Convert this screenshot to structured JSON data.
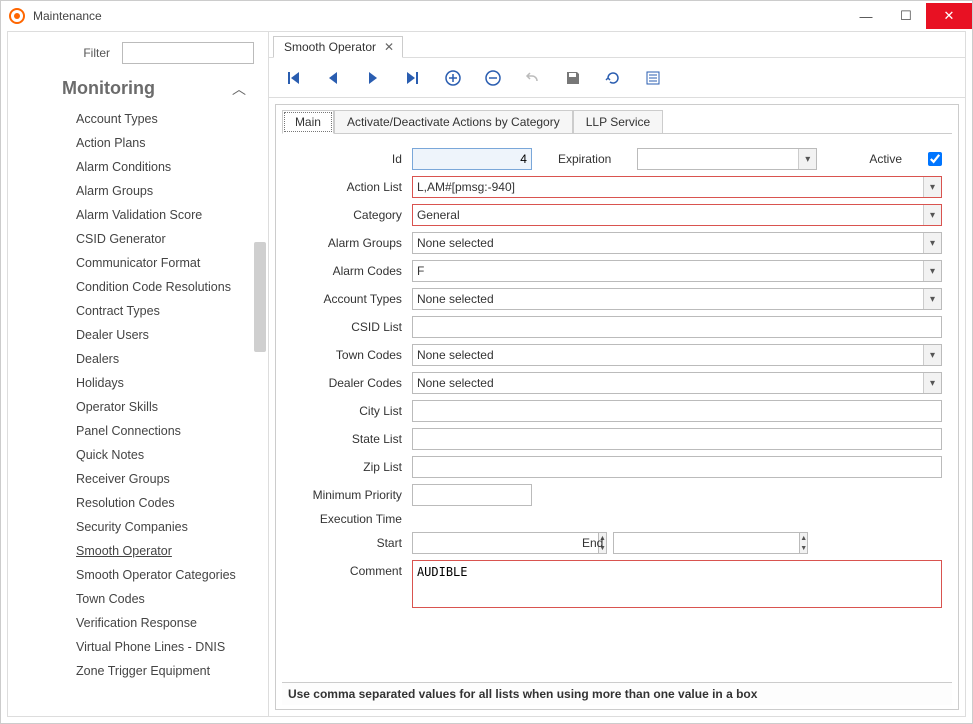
{
  "window": {
    "title": "Maintenance"
  },
  "sidebar": {
    "filter_label": "Filter",
    "filter_value": "",
    "section_title": "Monitoring",
    "items": [
      "Account Types",
      "Action Plans",
      "Alarm Conditions",
      "Alarm Groups",
      "Alarm Validation Score",
      "CSID Generator",
      "Communicator Format",
      "Condition Code Resolutions",
      "Contract Types",
      "Dealer Users",
      "Dealers",
      "Holidays",
      "Operator Skills",
      "Panel Connections",
      "Quick Notes",
      "Receiver Groups",
      "Resolution Codes",
      "Security Companies",
      "Smooth Operator",
      "Smooth Operator Categories",
      "Town Codes",
      "Verification Response",
      "Virtual Phone Lines - DNIS",
      "Zone Trigger Equipment"
    ],
    "selected_index": 18
  },
  "doc_tab": {
    "label": "Smooth Operator"
  },
  "subtabs": [
    "Main",
    "Activate/Deactivate Actions by Category",
    "LLP Service"
  ],
  "active_subtab": 0,
  "form": {
    "id_label": "Id",
    "id_value": "4",
    "expiration_label": "Expiration",
    "expiration_value": "",
    "active_label": "Active",
    "active_checked": true,
    "action_list_label": "Action List",
    "action_list_value": "L,AM#[pmsg:-940]",
    "category_label": "Category",
    "category_value": "General",
    "alarm_groups_label": "Alarm Groups",
    "alarm_groups_value": "None selected",
    "alarm_codes_label": "Alarm Codes",
    "alarm_codes_value": "F",
    "account_types_label": "Account Types",
    "account_types_value": "None selected",
    "csid_list_label": "CSID List",
    "csid_list_value": "",
    "town_codes_label": "Town Codes",
    "town_codes_value": "None selected",
    "dealer_codes_label": "Dealer Codes",
    "dealer_codes_value": "None selected",
    "city_list_label": "City List",
    "city_list_value": "",
    "state_list_label": "State List",
    "state_list_value": "",
    "zip_list_label": "Zip List",
    "zip_list_value": "",
    "min_priority_label": "Minimum Priority",
    "min_priority_value": "",
    "exec_time_label": "Execution Time",
    "start_label": "Start",
    "start_value": "",
    "end_label": "End",
    "end_value": "",
    "comment_label": "Comment",
    "comment_value": "AUDIBLE"
  },
  "status_hint": "Use comma separated values for all lists when using more than one value in a box",
  "toolbar_icons": [
    "first",
    "prev",
    "next",
    "last",
    "add",
    "remove",
    "undo",
    "save",
    "refresh",
    "list"
  ]
}
